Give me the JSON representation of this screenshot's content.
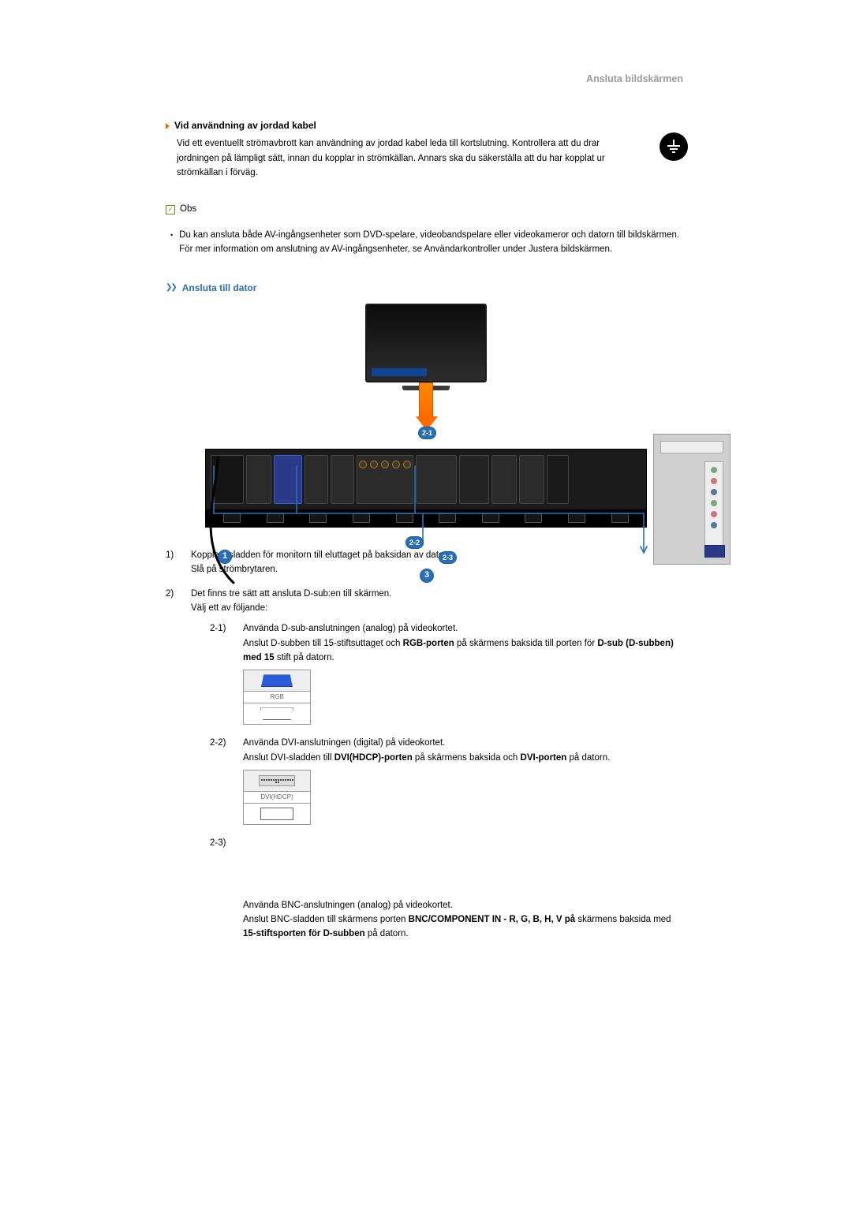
{
  "page": {
    "title_right": "Ansluta bildskärmen"
  },
  "section1": {
    "heading": "Vid användning av jordad kabel",
    "text": "Vid ett eventuellt strömavbrott kan användning av jordad kabel leda till kortslutning. Kontrollera att du drar jordningen på lämpligt sätt, innan du kopplar in strömkällan. Annars ska du säkerställa att du har kopplat ur strömkällan i förväg."
  },
  "obs": {
    "label": "Obs",
    "item1": "Du kan ansluta både AV-ingångsenheter som DVD-spelare, videobandspelare eller videokameror och datorn till bildskärmen. För mer information om anslutning av AV-ingångsenheter, se Användarkontroller under Justera bildskärmen."
  },
  "section2": {
    "heading": "Ansluta till dator"
  },
  "callouts": {
    "c21": "2-1",
    "c22": "2-2",
    "c23": "2-3",
    "c1": "1",
    "c3": "3"
  },
  "steps": {
    "s1num": "1)",
    "s1line1": "Koppla elsladden för monitorn till eluttaget på baksidan av datorn.",
    "s1line2": "Slå på strömbrytaren.",
    "s2num": "2)",
    "s2line1": "Det finns tre sätt att ansluta D-sub:en till skärmen.",
    "s2line2": "Välj ett av följande:",
    "sub21num": "2-1)",
    "sub21line1": "Använda D-sub-anslutningen (analog) på videokortet.",
    "sub21line2a": "Anslut D-subben till 15-stiftsuttaget och ",
    "sub21line2b": "RGB-porten",
    "sub21line2c": " på skärmens baksida till porten för ",
    "sub21line2d": "D-sub (D-subben) med 15",
    "sub21line2e": " stift på datorn.",
    "thumb21label": "RGB",
    "sub22num": "2-2)",
    "sub22line1": "Använda DVI-anslutningen (digital) på videokortet.",
    "sub22line2a": "Anslut DVI-sladden till ",
    "sub22line2b": "DVI(HDCP)-porten",
    "sub22line2c": " på skärmens baksida och ",
    "sub22line2d": "DVI-porten",
    "sub22line2e": " på datorn.",
    "thumb22label": "DVI(HDCP)",
    "sub23num": "2-3)",
    "sub23line1": "Använda BNC-anslutningen (analog) på videokortet.",
    "sub23line2a": "Anslut BNC-sladden till skärmens porten ",
    "sub23line2b": "BNC/COMPONENT IN - R, G, B, H, V på",
    "sub23line2c": " skärmens baksida med ",
    "sub23line2d": "15-stiftsporten för D-subben",
    "sub23line2e": " på datorn."
  }
}
